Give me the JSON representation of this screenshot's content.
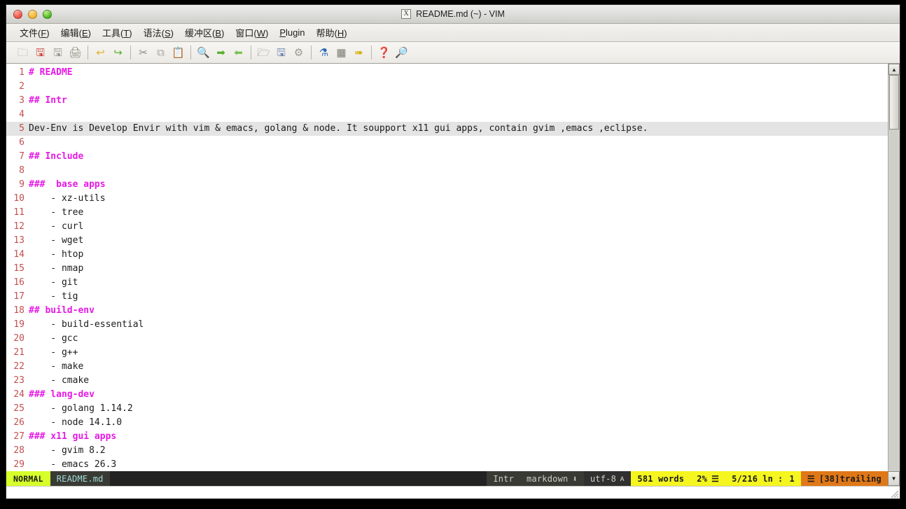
{
  "window": {
    "title": "README.md (~) - VIM",
    "vim_icon": "X",
    "traffic_lights": [
      "close-red",
      "minimize-yellow",
      "maximize-green"
    ]
  },
  "menubar": {
    "items": [
      {
        "label": "文件",
        "mnemonic": "F"
      },
      {
        "label": "编辑",
        "mnemonic": "E"
      },
      {
        "label": "工具",
        "mnemonic": "T"
      },
      {
        "label": "语法",
        "mnemonic": "S"
      },
      {
        "label": "缓冲区",
        "mnemonic": "B"
      },
      {
        "label": "窗口",
        "mnemonic": "W"
      },
      {
        "label": "Plugin",
        "mnemonic": "P",
        "inline": true
      },
      {
        "label": "帮助",
        "mnemonic": "H"
      }
    ]
  },
  "toolbar": {
    "buttons": [
      {
        "name": "open-file-icon",
        "glyph": "🗀",
        "color": "#9a9a90"
      },
      {
        "name": "save-file-icon",
        "glyph": "🖫",
        "color": "#c9372e"
      },
      {
        "name": "save-all-icon",
        "glyph": "🖫",
        "color": "#8f8f85"
      },
      {
        "name": "print-icon",
        "glyph": "🖨",
        "color": "#8f8f85"
      },
      {
        "name": "separator-1",
        "glyph": "",
        "color": ""
      },
      {
        "name": "undo-icon",
        "glyph": "↩",
        "color": "#e2b42a"
      },
      {
        "name": "redo-icon",
        "glyph": "↪",
        "color": "#5bb030"
      },
      {
        "name": "separator-2",
        "glyph": "",
        "color": ""
      },
      {
        "name": "cut-icon",
        "glyph": "✂",
        "color": "#8a8a80"
      },
      {
        "name": "copy-icon",
        "glyph": "⧉",
        "color": "#a3a399"
      },
      {
        "name": "paste-icon",
        "glyph": "📋",
        "color": "#c07a20"
      },
      {
        "name": "separator-3",
        "glyph": "",
        "color": ""
      },
      {
        "name": "find-icon",
        "glyph": "🔍",
        "color": "#b0672c"
      },
      {
        "name": "find-next-icon",
        "glyph": "➡",
        "color": "#5bb030"
      },
      {
        "name": "find-prev-icon",
        "glyph": "⬅",
        "color": "#7cc254"
      },
      {
        "name": "separator-4",
        "glyph": "",
        "color": ""
      },
      {
        "name": "load-session-icon",
        "glyph": "🗁",
        "color": "#8b8b81"
      },
      {
        "name": "save-session-icon",
        "glyph": "🖫",
        "color": "#5f7aa8"
      },
      {
        "name": "run-script-icon",
        "glyph": "⚙",
        "color": "#9a9a90"
      },
      {
        "name": "separator-5",
        "glyph": "",
        "color": ""
      },
      {
        "name": "make-icon",
        "glyph": "⚗",
        "color": "#2d6ab4"
      },
      {
        "name": "shell-icon",
        "glyph": "▦",
        "color": "#7a7a70"
      },
      {
        "name": "run-icon",
        "glyph": "➠",
        "color": "#d9b312"
      },
      {
        "name": "separator-6",
        "glyph": "",
        "color": ""
      },
      {
        "name": "help-icon",
        "glyph": "❓",
        "color": "#c23b2e"
      },
      {
        "name": "find-help-icon",
        "glyph": "🔎",
        "color": "#b92f22"
      }
    ]
  },
  "editor": {
    "lines": [
      {
        "n": "1",
        "text": "# README",
        "kind": "heading"
      },
      {
        "n": "2",
        "text": "",
        "kind": "plain"
      },
      {
        "n": "3",
        "text": "## Intr",
        "kind": "heading"
      },
      {
        "n": "4",
        "text": "",
        "kind": "plain"
      },
      {
        "n": "5",
        "text": "Dev-Env is Develop Envir with vim & emacs, golang & node. It soupport x11 gui apps, contain gvim ,emacs ,eclipse.",
        "kind": "plain",
        "cursor": true
      },
      {
        "n": "6",
        "text": "",
        "kind": "plain"
      },
      {
        "n": "7",
        "text": "## Include",
        "kind": "heading"
      },
      {
        "n": "8",
        "text": "",
        "kind": "plain"
      },
      {
        "n": "9",
        "text": "###  base apps",
        "kind": "heading"
      },
      {
        "n": "10",
        "text": "    - xz-utils",
        "kind": "plain"
      },
      {
        "n": "11",
        "text": "    - tree",
        "kind": "plain"
      },
      {
        "n": "12",
        "text": "    - curl",
        "kind": "plain"
      },
      {
        "n": "13",
        "text": "    - wget",
        "kind": "plain"
      },
      {
        "n": "14",
        "text": "    - htop",
        "kind": "plain"
      },
      {
        "n": "15",
        "text": "    - nmap",
        "kind": "plain"
      },
      {
        "n": "16",
        "text": "    - git",
        "kind": "plain"
      },
      {
        "n": "17",
        "text": "    - tig",
        "kind": "plain"
      },
      {
        "n": "18",
        "text": "## build-env",
        "kind": "heading"
      },
      {
        "n": "19",
        "text": "    - build-essential",
        "kind": "plain"
      },
      {
        "n": "20",
        "text": "    - gcc",
        "kind": "plain"
      },
      {
        "n": "21",
        "text": "    - g++",
        "kind": "plain"
      },
      {
        "n": "22",
        "text": "    - make",
        "kind": "plain"
      },
      {
        "n": "23",
        "text": "    - cmake",
        "kind": "plain"
      },
      {
        "n": "24",
        "text": "### lang-dev",
        "kind": "heading"
      },
      {
        "n": "25",
        "text": "    - golang 1.14.2",
        "kind": "plain"
      },
      {
        "n": "26",
        "text": "    - node 14.1.0",
        "kind": "plain"
      },
      {
        "n": "27",
        "text": "### x11 gui apps",
        "kind": "heading"
      },
      {
        "n": "28",
        "text": "    - gvim 8.2",
        "kind": "plain"
      },
      {
        "n": "29",
        "text": "    - emacs 26.3",
        "kind": "plain"
      }
    ]
  },
  "scrollbar": {
    "up_arrow": "▲",
    "down_arrow": "▼",
    "thumb_position_pct": 0
  },
  "statusline": {
    "mode": "NORMAL",
    "filename": "README.md",
    "section": "Intr",
    "filetype": "markdown",
    "filetype_icon": "⬇",
    "encoding": "utf-8",
    "encoding_icon": "ᴀ",
    "wordcount": "581 words",
    "scroll_pct": "2%",
    "scroll_icon": "☰",
    "position": "5/216",
    "line_label": "ln",
    "column_sep": ":",
    "column": "1",
    "warning_icon": "☰",
    "warning": "[38]trailing"
  },
  "colors": {
    "heading": "#e619e6",
    "linenum": "#c34f4f",
    "cursorline_bg": "#e4e4e4",
    "status_mode_bg": "#d7ff2a",
    "status_yellow": "#f5f520",
    "status_orange": "#e07818",
    "status_dark": "#1f1f1f",
    "filename_fg": "#9fdcd4"
  }
}
